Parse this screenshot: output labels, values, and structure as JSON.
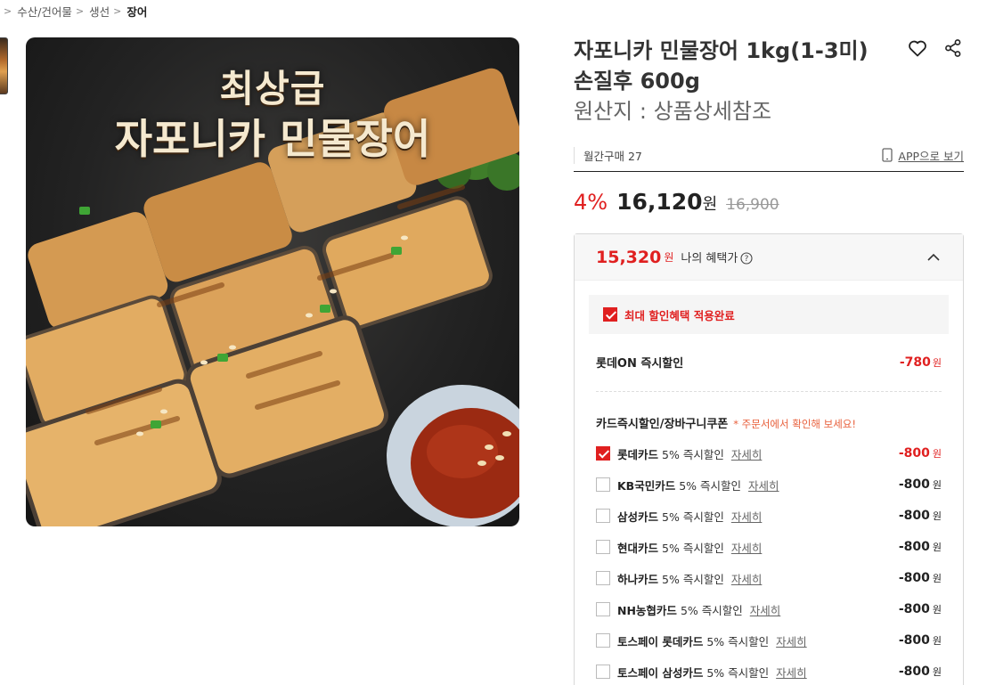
{
  "breadcrumb": {
    "items": [
      "수산/건어물",
      "생선",
      "장어"
    ]
  },
  "image": {
    "headline_line1": "최상급",
    "headline_line2": "자포니카 민물장어"
  },
  "product": {
    "title": "자포니카 민물장어 1kg(1-3미) 손질후 600g",
    "origin": "원산지 : 상품상세참조",
    "monthly_purchase": "월간구매 27",
    "app_link": "APP으로 보기",
    "discount_rate": "4%",
    "price": "16,120",
    "price_unit": "원",
    "original_price": "16,900"
  },
  "icons": {
    "wishlist": "heart-icon",
    "share": "share-icon",
    "mobile": "mobile-icon"
  },
  "benefit": {
    "price": "15,320",
    "price_unit": "원",
    "label": "나의 혜택가",
    "applied_label": "최대 할인혜택 적용완료",
    "instant": {
      "name": "롯데ON 즉시할인",
      "amount": "-780",
      "unit": "원"
    },
    "card_section_title": "카드즉시할인/장바구니쿠폰",
    "card_section_note": "* 주문서에서 확인해 보세요!",
    "detail_label": "자세히",
    "cards": [
      {
        "name": "롯데카드",
        "desc": "5% 즉시할인",
        "amount": "-800",
        "unit": "원",
        "checked": true
      },
      {
        "name": "KB국민카드",
        "desc": "5% 즉시할인",
        "amount": "-800",
        "unit": "원",
        "checked": false
      },
      {
        "name": "삼성카드",
        "desc": "5% 즉시할인",
        "amount": "-800",
        "unit": "원",
        "checked": false
      },
      {
        "name": "현대카드",
        "desc": "5% 즉시할인",
        "amount": "-800",
        "unit": "원",
        "checked": false
      },
      {
        "name": "하나카드",
        "desc": "5% 즉시할인",
        "amount": "-800",
        "unit": "원",
        "checked": false
      },
      {
        "name": "NH농협카드",
        "desc": "5% 즉시할인",
        "amount": "-800",
        "unit": "원",
        "checked": false
      },
      {
        "name": "토스페이 롯데카드",
        "desc": "5% 즉시할인",
        "amount": "-800",
        "unit": "원",
        "checked": false
      },
      {
        "name": "토스페이 삼성카드",
        "desc": "5% 즉시할인",
        "amount": "-800",
        "unit": "원",
        "checked": false
      }
    ]
  },
  "colors": {
    "accent": "#e02020",
    "note": "#e8603c"
  }
}
